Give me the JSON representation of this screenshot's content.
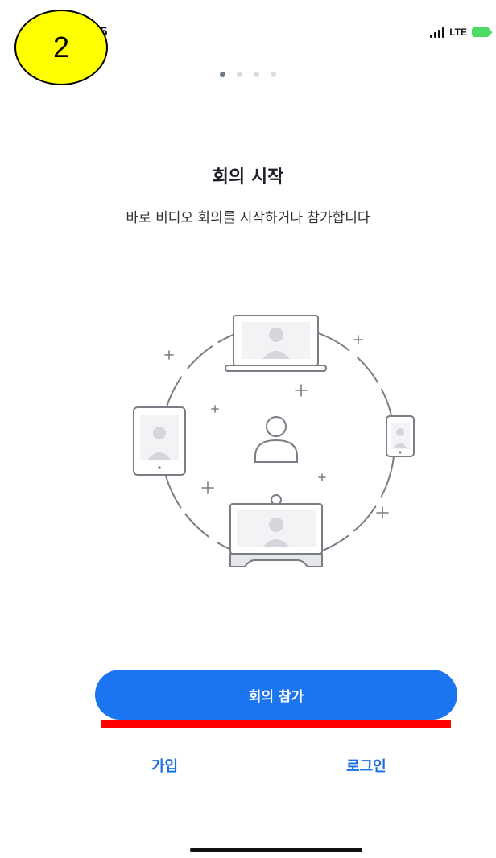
{
  "status_bar": {
    "time": "5",
    "network": "LTE",
    "signal_icon": "signal-bars-icon",
    "battery_icon": "battery-charging-icon"
  },
  "step_badge": "2",
  "pager": {
    "total": 4,
    "active": 0
  },
  "onboarding": {
    "title": "회의 시작",
    "subtitle": "바로 비디오 회의를 시작하거나 참가합니다",
    "illustration_icon": "video-meeting-devices-illustration"
  },
  "actions": {
    "join_label": "회의 참가",
    "signup_label": "가입",
    "login_label": "로그인"
  },
  "colors": {
    "primary": "#1b74f0",
    "link": "#1b6fe0",
    "highlight": "#ff0000",
    "badge": "#ffff00"
  }
}
